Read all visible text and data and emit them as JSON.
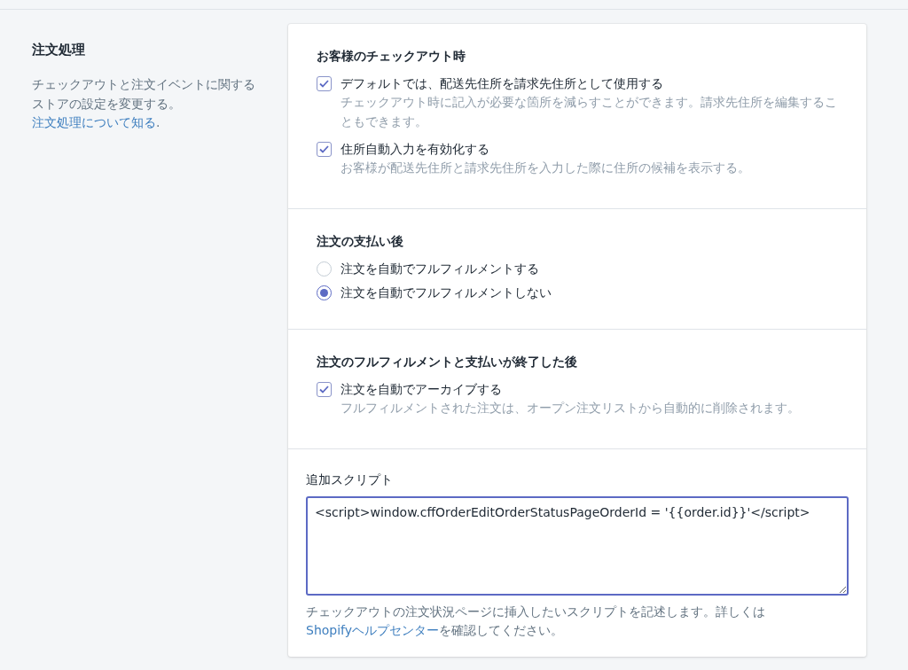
{
  "section": {
    "title": "注文処理",
    "description": {
      "text": "チェックアウトと注文イベントに関するストアの設定を変更する。 ",
      "link": "注文処理について知る",
      "after": "."
    }
  },
  "groups": [
    {
      "kind": "checkbox",
      "title": "お客様のチェックアウト時",
      "options": [
        {
          "label": "デフォルトでは、配送先住所を請求先住所として使用する",
          "help": "チェックアウト時に記入が必要な箇所を減らすことができます。請求先住所を編集することもできます。",
          "checked": true
        },
        {
          "label": "住所自動入力を有効化する",
          "help": "お客様が配送先住所と請求先住所を入力した際に住所の候補を表示する。",
          "checked": true
        }
      ]
    },
    {
      "kind": "radio",
      "title": "注文の支払い後",
      "options": [
        {
          "label": "注文を自動でフルフィルメントする",
          "selected": false
        },
        {
          "label": "注文を自動でフルフィルメントしない",
          "selected": true
        }
      ]
    },
    {
      "kind": "checkbox",
      "title": "注文のフルフィルメントと支払いが終了した後",
      "options": [
        {
          "label": "注文を自動でアーカイブする",
          "help": "フルフィルメントされた注文は、オープン注文リストから自動的に削除されます。",
          "checked": true
        }
      ]
    },
    {
      "kind": "textarea",
      "label": "追加スクリプト",
      "value": "<script>window.cffOrderEditOrderStatusPageOrderId = '{{order.id}}'</script>",
      "help": "チェックアウトの注文状況ページに挿入したいスクリプトを記述します。詳しくは",
      "link": "Shopifyヘルプセンター",
      "after": "を確認してください。"
    }
  ]
}
